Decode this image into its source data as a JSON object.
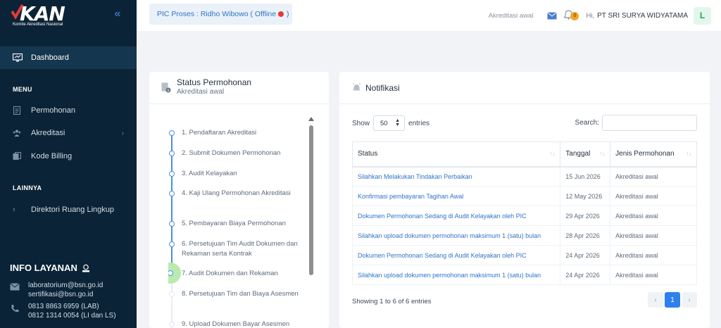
{
  "brand": {
    "logo_text": "KAN",
    "logo_subtitle": "Komite Akreditasi Nasional"
  },
  "sidebar": {
    "dashboard_label": "Dashboard",
    "menu_heading": "MENU",
    "menu_items": [
      {
        "label": "Permohonan",
        "icon": "document-icon"
      },
      {
        "label": "Akreditasi",
        "icon": "users-icon"
      },
      {
        "label": "Kode Billing",
        "icon": "billing-icon"
      }
    ],
    "lainnya_heading": "LAINNYA",
    "lainnya_items": [
      {
        "label": "Direktori Ruang Lingkup"
      }
    ],
    "info_title": "INFO LAYANAN",
    "emails": [
      "laboratorium@bsn.go.id",
      "sertifikasi@bsn.go.id"
    ],
    "phones": [
      "0813 8863 6959 (LAB)",
      "0812 1314 0054 (LI dan LS)"
    ]
  },
  "topbar": {
    "pic_status": "PIC Proses : Ridho Wibowo ( Offline",
    "pic_status_close": ")",
    "mode": "Akreditasi awal",
    "notif_count": "0",
    "greeting": "Hi,",
    "user_name": "PT SRI SURYA WIDYATAMA",
    "avatar_letter": "L"
  },
  "status_card": {
    "title": "Status Permohonan",
    "subtitle": "Akreditasi awal",
    "steps": [
      "1. Pendaftaran Akreditasi",
      "2. Submit Dokumen Permohonan",
      "3. Audit Kelayakan",
      "4. Kaji Ulang Permohonan Akreditasi",
      "5. Pembayaran Biaya Permohonan",
      "6. Persetujuan Tim Audit Dokumen dan Rekaman serta Kontrak",
      "7. Audit Dokumen dan Rekaman",
      "8. Persetujuan Tim dan Biaya Asesmen",
      "9. Upload Dokumen Bayar Asesmen"
    ]
  },
  "notif_card": {
    "title": "Notifikasi",
    "show_label": "Show",
    "entries_value": "50",
    "entries_label": "entries",
    "search_label": "Search:",
    "columns": [
      "Status",
      "Tanggal",
      "Jenis Permohonan"
    ],
    "rows": [
      {
        "status": "Silahkan Melakukan Tindakan Perbaikan",
        "tanggal": "15 Jun 2026",
        "jenis": "Akreditasi awal"
      },
      {
        "status": "Konfirmasi pembayaran Tagihan Awal",
        "tanggal": "12 May 2026",
        "jenis": "Akreditasi awal"
      },
      {
        "status": "Dokumen Permohonan Sedang di Audit Kelayakan oleh PIC",
        "tanggal": "29 Apr 2026",
        "jenis": "Akreditasi awal"
      },
      {
        "status": "Silahkan upload dokumen permohonan maksimum 1 (satu) bulan",
        "tanggal": "28 Apr 2026",
        "jenis": "Akreditasi awal"
      },
      {
        "status": "Dokumen Permohonan Sedang di Audit Kelayakan oleh PIC",
        "tanggal": "24 Apr 2026",
        "jenis": "Akreditasi awal"
      },
      {
        "status": "Silahkan upload dokumen permohonan maksimum 1 (satu) bulan",
        "tanggal": "24 Apr 2026",
        "jenis": "Akreditasi awal"
      }
    ],
    "showing_text": "Showing 1 to 6 of 6 entries",
    "current_page": "1"
  },
  "colors": {
    "sidebar_bg": "#0b2336",
    "accent": "#2f80ed",
    "link": "#2f73c9",
    "offline_dot": "#e53935",
    "active_step": "#b9eab0"
  }
}
